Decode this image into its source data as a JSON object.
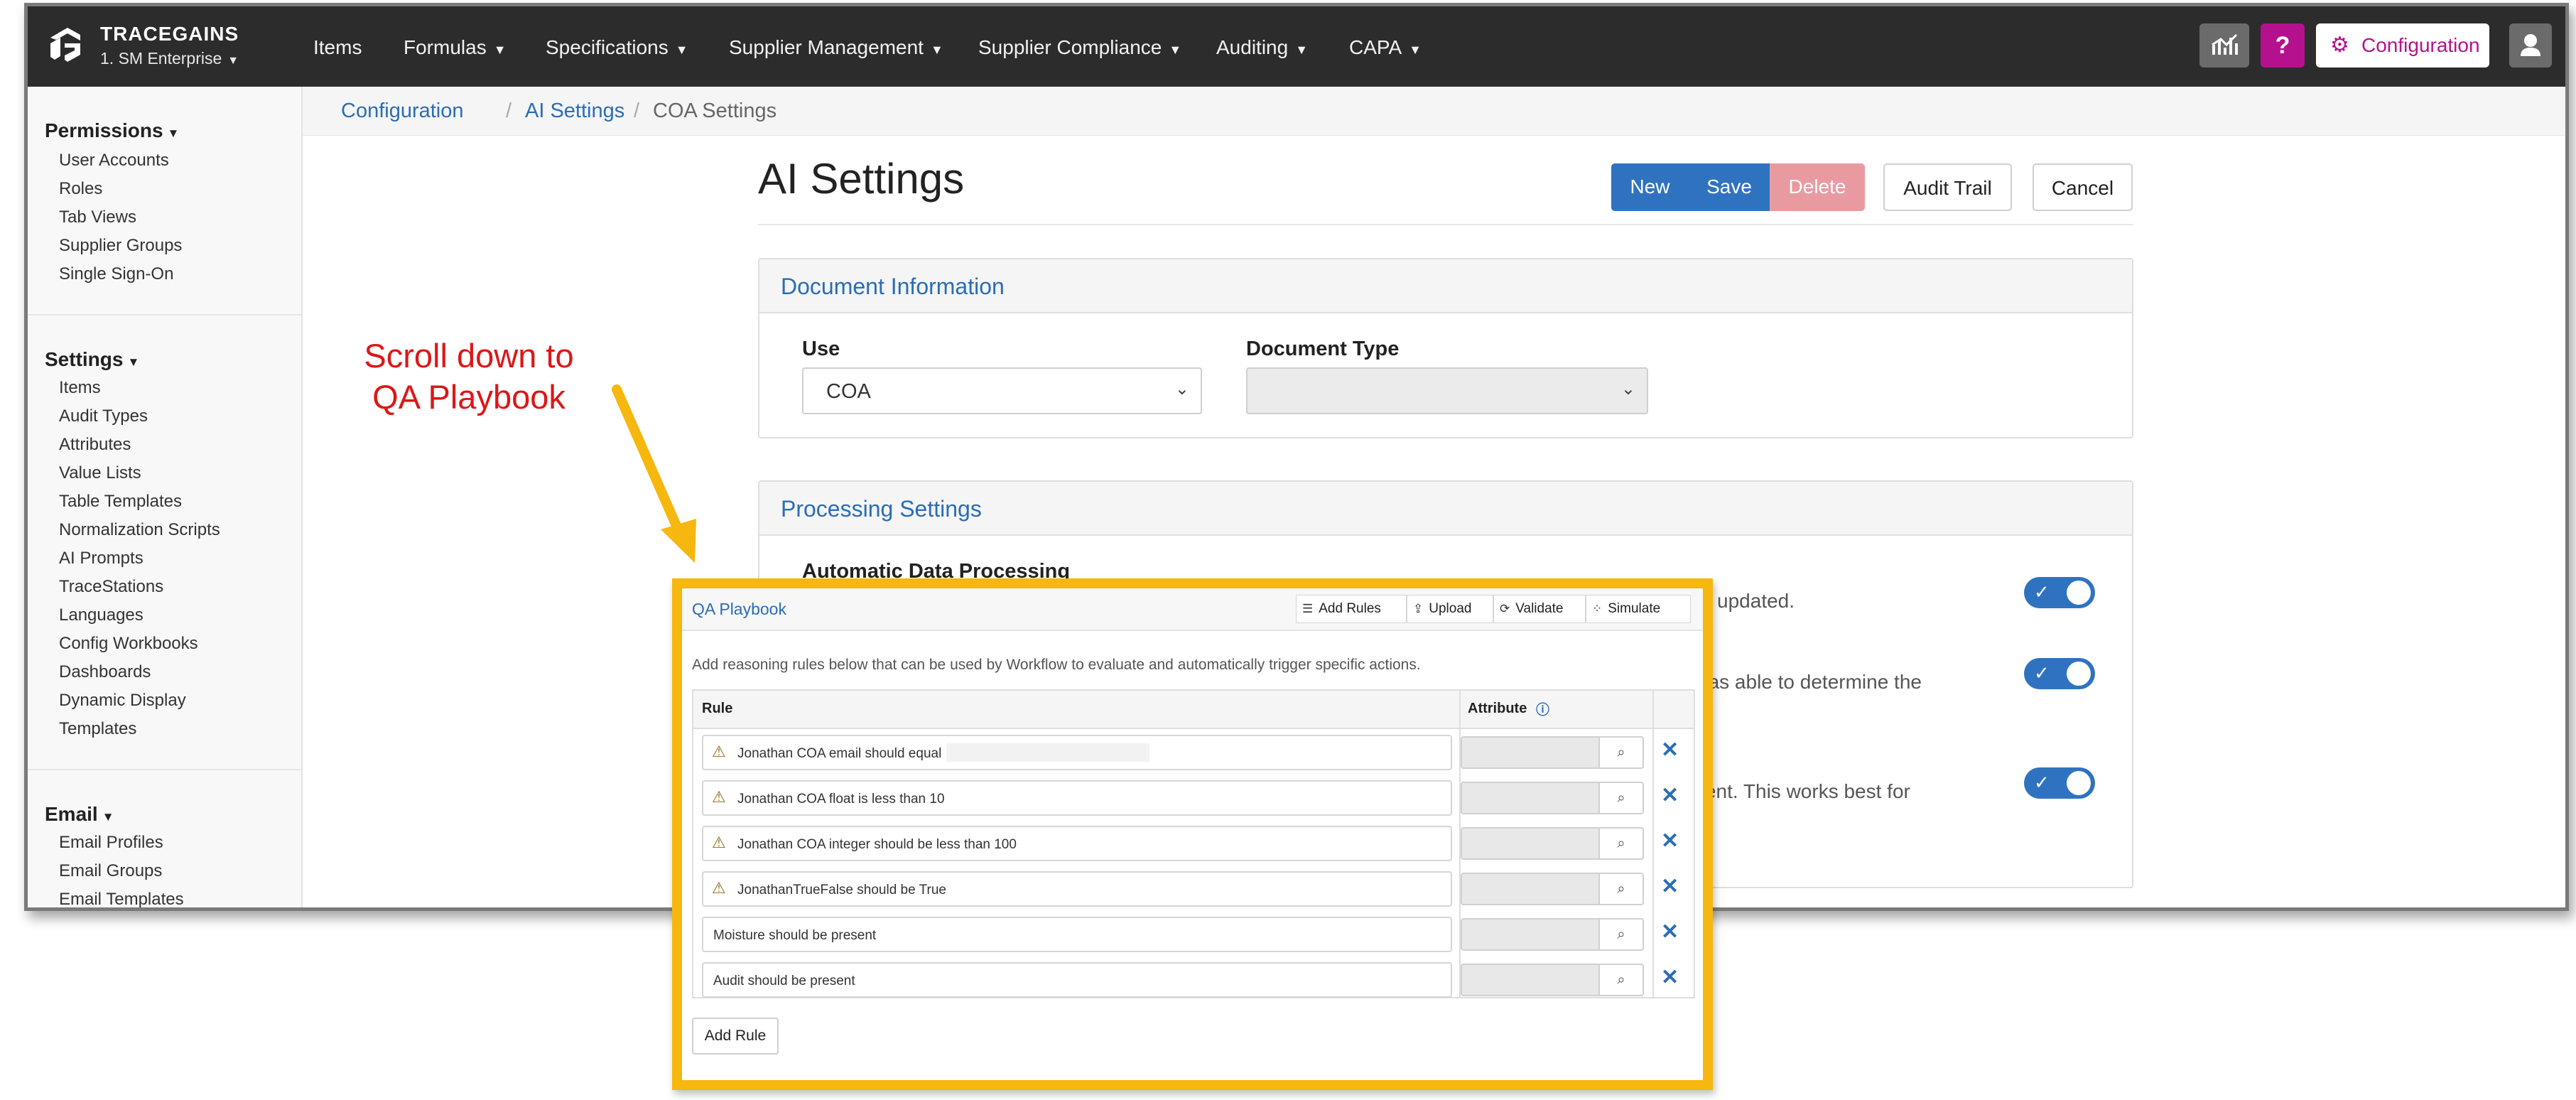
{
  "app": {
    "brand": "TRACEGAINS",
    "org": "1. SM Enterprise",
    "nav": [
      "Items",
      "Formulas",
      "Specifications",
      "Supplier Management",
      "Supplier Compliance",
      "Auditing",
      "CAPA"
    ],
    "help_label": "?",
    "config_label": "Configuration"
  },
  "sidebar": {
    "groups": [
      {
        "title": "Permissions",
        "items": [
          "User Accounts",
          "Roles",
          "Tab Views",
          "Supplier Groups",
          "Single Sign-On"
        ]
      },
      {
        "title": "Settings",
        "items": [
          "Items",
          "Audit Types",
          "Attributes",
          "Value Lists",
          "Table Templates",
          "Normalization Scripts",
          "AI Prompts",
          "TraceStations",
          "Languages",
          "Config Workbooks",
          "Dashboards",
          "Dynamic Display",
          "Templates"
        ]
      },
      {
        "title": "Email",
        "items": [
          "Email Profiles",
          "Email Groups",
          "Email Templates"
        ]
      }
    ]
  },
  "breadcrumb": {
    "items": [
      "Configuration",
      "AI Settings",
      "COA Settings"
    ],
    "separator": "/"
  },
  "page": {
    "title": "AI Settings"
  },
  "actions": {
    "new": "New",
    "save": "Save",
    "delete": "Delete",
    "audit_trail": "Audit Trail",
    "cancel": "Cancel"
  },
  "doc_info": {
    "title": "Document Information",
    "use_label": "Use",
    "use_value": "COA",
    "doctype_label": "Document Type",
    "doctype_value": ""
  },
  "processing": {
    "title": "Processing Settings",
    "automatic_title": "Automatic Data Processing",
    "desc_1": "d or updated.",
    "desc_2": "n was able to determine the",
    "desc_3": "ontent. This works best for",
    "toggles": [
      true,
      true,
      true
    ]
  },
  "annotation": {
    "line1": "Scroll down to",
    "line2": "QA Playbook"
  },
  "playbook": {
    "title": "QA Playbook",
    "tools": [
      "Add Rules",
      "Upload",
      "Validate",
      "Simulate"
    ],
    "hint": "Add reasoning rules below that can be used by Workflow to evaluate and automatically trigger specific actions.",
    "col_rule": "Rule",
    "col_attribute": "Attribute",
    "rules": [
      {
        "text": "Jonathan COA email should equal",
        "warning": true
      },
      {
        "text": "Jonathan COA float is less than 10",
        "warning": true
      },
      {
        "text": "Jonathan COA integer should be less than 100",
        "warning": true
      },
      {
        "text": "JonathanTrueFalse should be True",
        "warning": true
      },
      {
        "text": "Moisture should be present",
        "warning": false
      },
      {
        "text": "Audit should be present",
        "warning": false
      }
    ],
    "add_rule": "Add Rule"
  },
  "colors": {
    "nav_bg": "#2c2c2c",
    "accent_blue": "#2f73c0",
    "brand_magenta": "#b5118e",
    "highlight_yellow": "#f6b70e",
    "annotation_red": "#dd1616"
  }
}
